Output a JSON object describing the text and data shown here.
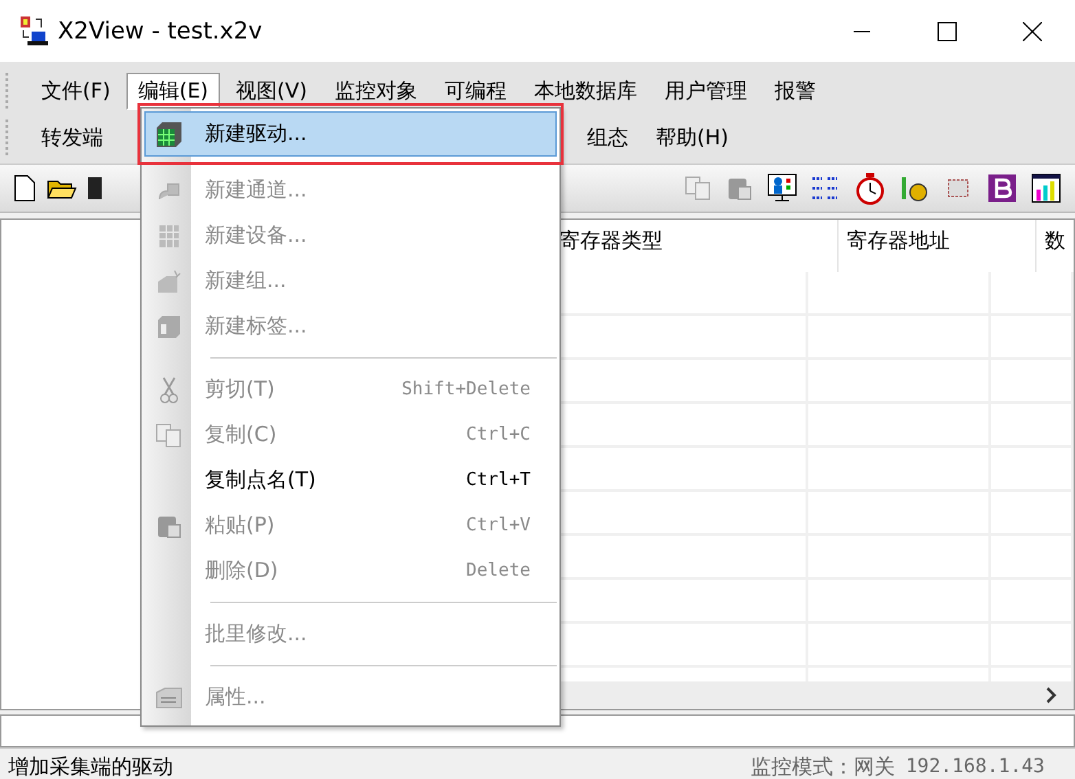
{
  "window": {
    "title": "X2View - test.x2v"
  },
  "menu_bar": {
    "items": [
      {
        "label": "文件(F)",
        "selected": false
      },
      {
        "label": "编辑(E)",
        "selected": true
      },
      {
        "label": "视图(V)",
        "selected": false
      },
      {
        "label": "监控对象",
        "selected": false
      },
      {
        "label": "可编程",
        "selected": false
      },
      {
        "label": "本地数据库",
        "selected": false
      },
      {
        "label": "用户管理",
        "selected": false
      },
      {
        "label": "报警",
        "selected": false
      }
    ]
  },
  "menu_bar_second_line": {
    "items": [
      {
        "label": "转发端",
        "selected": false
      },
      {
        "label": "组态",
        "selected": false
      },
      {
        "label": "帮助(H)",
        "selected": false
      }
    ]
  },
  "edit_menu": {
    "items": [
      {
        "kind": "item",
        "label": "新建驱动...",
        "disabled": false,
        "selected": true
      },
      {
        "kind": "item",
        "label": "新建通道...",
        "disabled": true,
        "selected": false
      },
      {
        "kind": "item",
        "label": "新建设备...",
        "disabled": true,
        "selected": false
      },
      {
        "kind": "item",
        "label": "新建组...",
        "disabled": true,
        "selected": false
      },
      {
        "kind": "item",
        "label": "新建标签...",
        "disabled": true,
        "selected": false
      },
      {
        "kind": "separator"
      },
      {
        "kind": "item",
        "label": "剪切(T)",
        "shortcut": "Shift+Delete",
        "disabled": true,
        "selected": false
      },
      {
        "kind": "item",
        "label": "复制(C)",
        "shortcut": "Ctrl+C",
        "disabled": true,
        "selected": false
      },
      {
        "kind": "item",
        "label": "复制点名(T)",
        "shortcut": "Ctrl+T",
        "disabled": false,
        "selected": false
      },
      {
        "kind": "item",
        "label": "粘贴(P)",
        "shortcut": "Ctrl+V",
        "disabled": true,
        "selected": false
      },
      {
        "kind": "item",
        "label": "删除(D)",
        "shortcut": "Delete",
        "disabled": true,
        "selected": false
      },
      {
        "kind": "separator"
      },
      {
        "kind": "item",
        "label": "批里修改...",
        "disabled": true,
        "selected": false
      },
      {
        "kind": "separator"
      },
      {
        "kind": "item",
        "label": "属性...",
        "disabled": true,
        "selected": false
      }
    ]
  },
  "table": {
    "columns": [
      "寄存器类型",
      "寄存器地址",
      "数"
    ]
  },
  "status_bar": {
    "message": "增加采集端的驱动",
    "mode": "监控模式：网关",
    "address": "192.168.1.43"
  }
}
